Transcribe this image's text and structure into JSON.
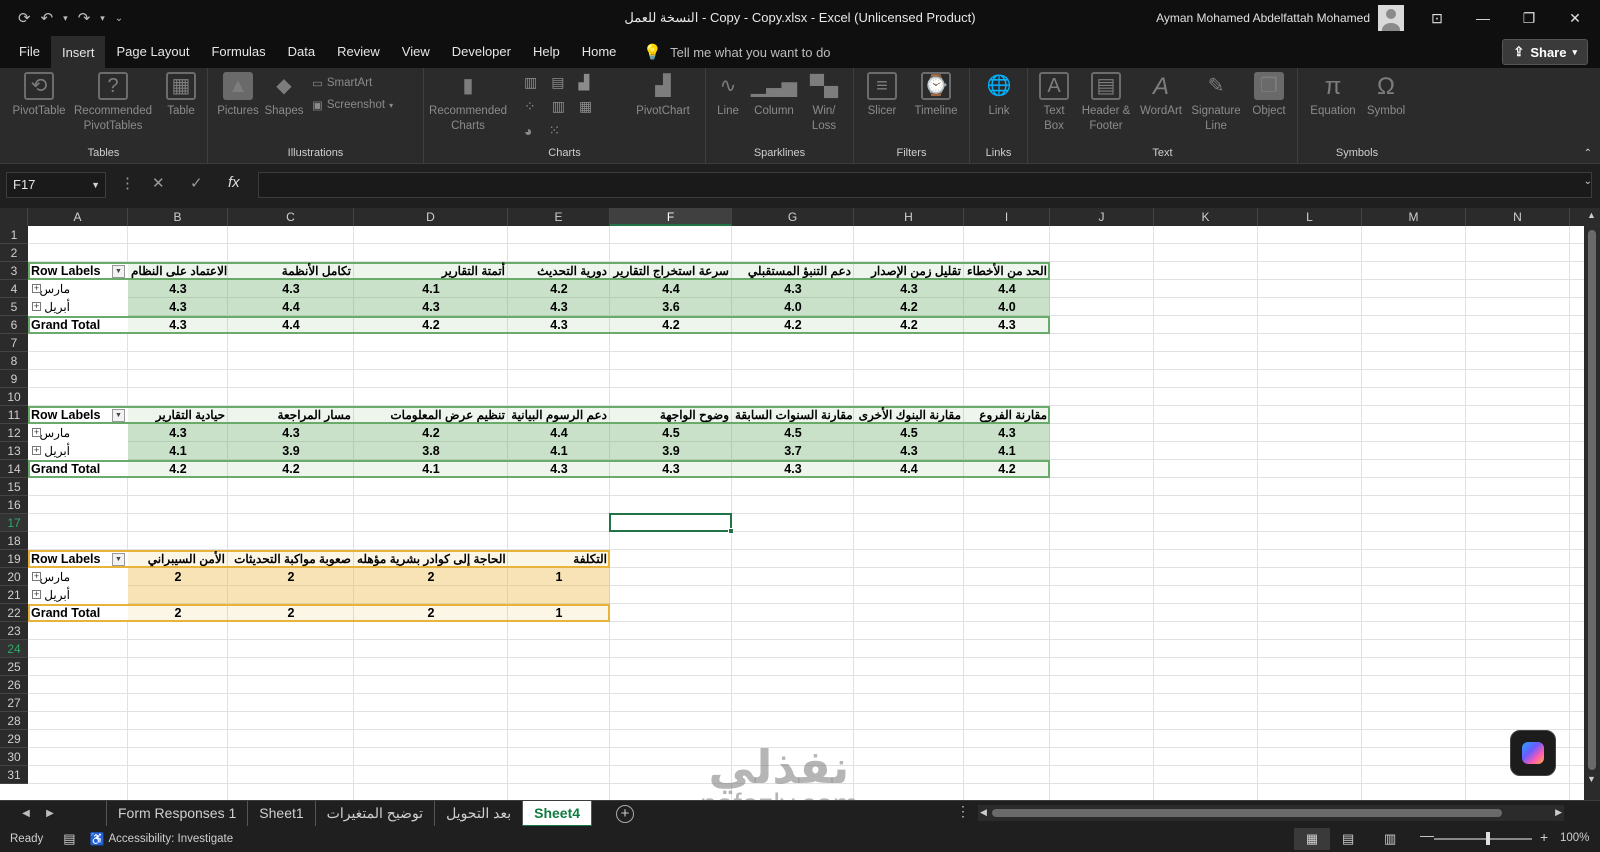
{
  "window": {
    "title": "النسخة للعمل - Copy - Copy.xlsx  -  Excel (Unlicensed Product)",
    "user": "Ayman Mohamed Abdelfattah Mohamed"
  },
  "menu": {
    "items": [
      "File",
      "Insert",
      "Page Layout",
      "Formulas",
      "Data",
      "Review",
      "View",
      "Developer",
      "Help",
      "Home"
    ],
    "active": "Insert",
    "tell_me": "Tell me what you want to do",
    "share": "Share"
  },
  "ribbon": {
    "groups": [
      {
        "label": "Tables",
        "buttons": [
          "PivotTable",
          "Recommended PivotTables",
          "Table"
        ]
      },
      {
        "label": "Illustrations",
        "buttons": [
          "Pictures",
          "Shapes"
        ],
        "small": [
          "SmartArt",
          "Screenshot"
        ]
      },
      {
        "label": "Charts",
        "buttons": [
          "Recommended Charts",
          "PivotChart"
        ]
      },
      {
        "label": "Sparklines",
        "buttons": [
          "Line",
          "Column",
          "Win/ Loss"
        ]
      },
      {
        "label": "Filters",
        "buttons": [
          "Slicer",
          "Timeline"
        ]
      },
      {
        "label": "Links",
        "buttons": [
          "Link"
        ]
      },
      {
        "label": "Text",
        "buttons": [
          "Text Box",
          "Header & Footer",
          "WordArt",
          "Signature Line",
          "Object"
        ]
      },
      {
        "label": "Symbols",
        "buttons": [
          "Equation",
          "Symbol"
        ]
      }
    ]
  },
  "formula_bar": {
    "name_box": "F17",
    "fx": "fx",
    "value": ""
  },
  "grid": {
    "columns": [
      "A",
      "B",
      "C",
      "D",
      "E",
      "F",
      "G",
      "H",
      "I",
      "J",
      "K",
      "L",
      "M",
      "N"
    ],
    "selected_column": "F",
    "selected_row": "17",
    "rows": [
      "1",
      "2",
      "3",
      "4",
      "5",
      "6",
      "7",
      "8",
      "9",
      "10",
      "11",
      "12",
      "13",
      "14",
      "15",
      "16",
      "17",
      "18",
      "19",
      "20",
      "21",
      "22",
      "23",
      "24",
      "25",
      "26",
      "27",
      "28",
      "29",
      "30",
      "31"
    ],
    "highlighted_rows": [
      "17",
      "24"
    ]
  },
  "pivots": [
    {
      "header_label": "Row Labels",
      "headers": [
        "الاعتماد على النظام",
        "تكامل الأنظمة",
        "أتمتة التقارير",
        "دورية التحديث",
        "سرعة استخراج التقارير",
        "دعم التنبؤ المستقبلي",
        "تقليل زمن الإصدار",
        "الحد من الأخطاء"
      ],
      "rows": [
        {
          "label": "مارس",
          "values": [
            "4.3",
            "4.3",
            "4.1",
            "4.2",
            "4.4",
            "4.3",
            "4.3",
            "4.4"
          ]
        },
        {
          "label": "أبريل",
          "values": [
            "4.3",
            "4.4",
            "4.3",
            "4.3",
            "3.6",
            "4.0",
            "4.2",
            "4.0"
          ]
        }
      ],
      "total_label": "Grand Total",
      "totals": [
        "4.3",
        "4.4",
        "4.2",
        "4.3",
        "4.2",
        "4.2",
        "4.2",
        "4.3"
      ],
      "color": "#6aaa6a"
    },
    {
      "header_label": "Row Labels",
      "headers": [
        "حيادية التقارير",
        "مسار المراجعة",
        "تنظيم عرض المعلومات",
        "دعم الرسوم البيانية",
        "وضوح الواجهة",
        "مقارنة السنوات السابقة",
        "مقارنة البنوك الأخرى",
        "مقارنة الفروع"
      ],
      "rows": [
        {
          "label": "مارس",
          "values": [
            "4.3",
            "4.3",
            "4.2",
            "4.4",
            "4.5",
            "4.5",
            "4.5",
            "4.3"
          ]
        },
        {
          "label": "أبريل",
          "values": [
            "4.1",
            "3.9",
            "3.8",
            "4.1",
            "3.9",
            "3.7",
            "4.3",
            "4.1"
          ]
        }
      ],
      "total_label": "Grand Total",
      "totals": [
        "4.2",
        "4.2",
        "4.1",
        "4.3",
        "4.3",
        "4.3",
        "4.4",
        "4.2"
      ],
      "color": "#6aaa6a"
    },
    {
      "header_label": "Row Labels",
      "headers": [
        "الأمن السيبراني",
        "صعوبة مواكبة التحديثات",
        "الحاجة إلى كوادر بشرية مؤهله",
        "التكلفة"
      ],
      "rows": [
        {
          "label": "مارس",
          "values": [
            "2",
            "2",
            "2",
            "1"
          ]
        },
        {
          "label": "أبريل",
          "values": [
            "",
            "",
            "",
            ""
          ]
        }
      ],
      "total_label": "Grand Total",
      "totals": [
        "2",
        "2",
        "2",
        "1"
      ],
      "color": "#e8b33a"
    }
  ],
  "sheet_tabs": {
    "tabs": [
      "Form Responses 1",
      "Sheet1",
      "توضيح المتغيرات",
      "بعد التحويل",
      "Sheet4"
    ],
    "active": "Sheet4"
  },
  "status": {
    "ready": "Ready",
    "accessibility": "Accessibility: Investigate",
    "zoom": "100%"
  },
  "watermark": {
    "arabic": "نفذلي",
    "latin": "nafezly.com"
  }
}
